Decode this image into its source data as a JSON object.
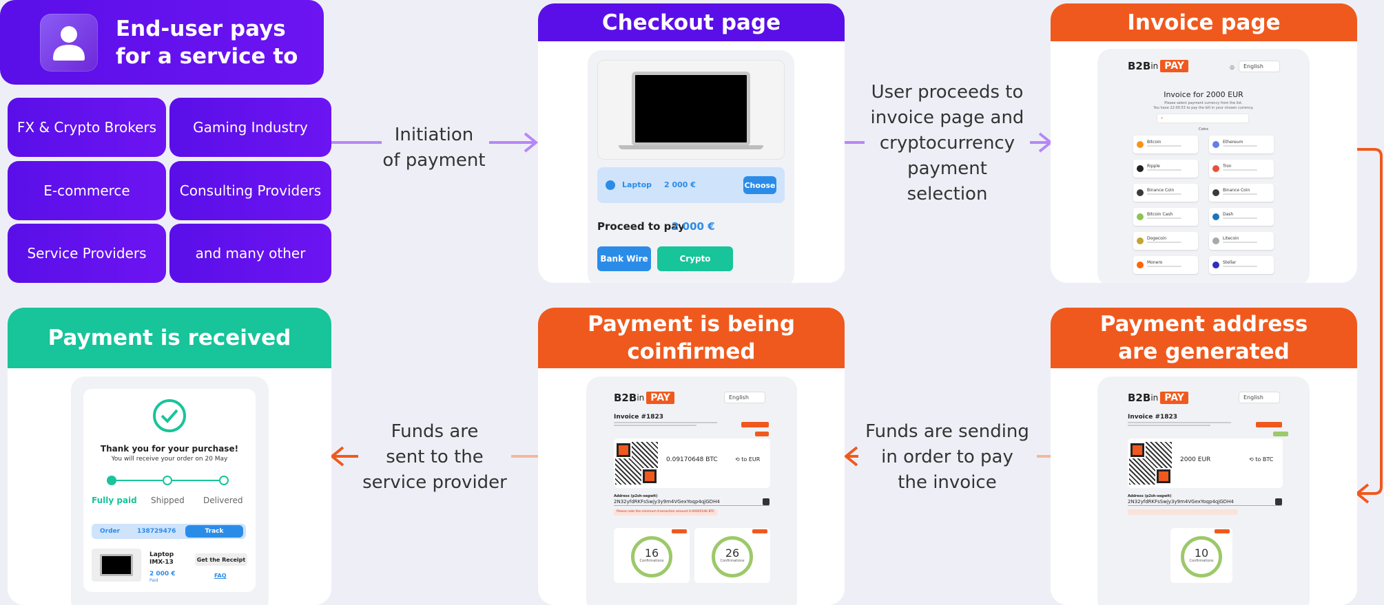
{
  "hero": {
    "text_line1": "End-user pays",
    "text_line2": "for a service to",
    "icon": "user-icon"
  },
  "tiles": [
    {
      "label": "FX & Crypto Brokers"
    },
    {
      "label": "Gaming Industry"
    },
    {
      "label": "E-commerce"
    },
    {
      "label": "Consulting Providers"
    },
    {
      "label": "Service Providers"
    },
    {
      "label": "and many other"
    }
  ],
  "steps": {
    "initiation": {
      "line1": "Initiation",
      "line2": "of payment"
    },
    "proceed": {
      "line1": "User proceeds to",
      "line2": "invoice page and",
      "line3": "cryptocurrency",
      "line4": "payment",
      "line5": "selection"
    },
    "sending": {
      "line1": "Funds are sending",
      "line2": "in order to pay",
      "line3": "the invoice"
    },
    "sent": {
      "line1": "Funds are",
      "line2": "sent to the",
      "line3": "service provider"
    }
  },
  "checkout": {
    "title": "Checkout page",
    "item_name": "Laptop",
    "item_price": "2 000 €",
    "choose_label": "Choose",
    "proceed_label": "Proceed to pay",
    "proceed_amount": "2 000 €",
    "bank_label": "Bank Wire",
    "crypto_label": "Crypto"
  },
  "invoice": {
    "title": "Invoice page",
    "logo_b2b": "B2B",
    "logo_in": "in",
    "logo_pay": "PAY",
    "language": "English",
    "heading": "Invoice for 2000 EUR",
    "sub1": "Please select payment currency from the list.",
    "sub2": "You have 22:00:53 to pay the bill in your chosen currency.",
    "coins_label": "Coins",
    "coins": [
      {
        "name": "Bitcoin",
        "color": "#f7931a"
      },
      {
        "name": "Ethereum",
        "color": "#627eea"
      },
      {
        "name": "Ripple",
        "color": "#222222"
      },
      {
        "name": "Tron",
        "color": "#e8503a"
      },
      {
        "name": "Binance Coin",
        "color": "#3a3a3a"
      },
      {
        "name": "Binance Coin",
        "color": "#3a3a3a"
      },
      {
        "name": "Bitcoin Cash",
        "color": "#8dc351"
      },
      {
        "name": "Dash",
        "color": "#1c75bc"
      },
      {
        "name": "Dogecoin",
        "color": "#c2a633"
      },
      {
        "name": "Litecoin",
        "color": "#a6a9aa"
      },
      {
        "name": "Monero",
        "color": "#ff6600"
      },
      {
        "name": "Stellar",
        "color": "#2e2ebf"
      }
    ]
  },
  "address": {
    "title_line1": "Payment address",
    "title_line2": "are generated",
    "invoice_no": "Invoice #1823",
    "amount": "2000 EUR",
    "to_label": "to BTC",
    "address_label": "Address (p2sh-segwit)",
    "address_value": "2N32yfdRKFsSwjy3y9m4VGexYoqp4qjGDH4",
    "confirmations": "10",
    "confirm_label": "Confirmations"
  },
  "confirming": {
    "title_line1": "Payment is being",
    "title_line2": "coinfirmed",
    "invoice_no": "Invoice #1823",
    "amount": "0.09170648 BTC",
    "to_label": "to EUR",
    "address_label": "Address (p2sh-segwit)",
    "address_value": "2N32yfdRKFsSwjy3y9m4VGexYoqp4qjGDH4",
    "warning": "Please note the minimum transaction amount 0.00005546 BTC",
    "conf1": "16",
    "conf2": "26",
    "confirm_label": "Confirmations"
  },
  "received": {
    "title": "Payment is received",
    "thanks": "Thank you for your purchase!",
    "sub": "You will receive your order on 20 May",
    "step1": "Fully paid",
    "step2": "Shipped",
    "step3": "Delivered",
    "order_label": "Order",
    "order_no": "138729476",
    "track_label": "Track",
    "product_line1": "Laptop",
    "product_line2": "IMX-13",
    "product_price": "2 000 €",
    "product_status": "Paid",
    "receipt_label": "Get the Receipt",
    "faq_label": "FAQ"
  },
  "colors": {
    "purple": "#5a0fe8",
    "orange": "#f0591d",
    "green": "#18c49a",
    "blue": "#2b8ce8",
    "teal": "#18c49a"
  }
}
